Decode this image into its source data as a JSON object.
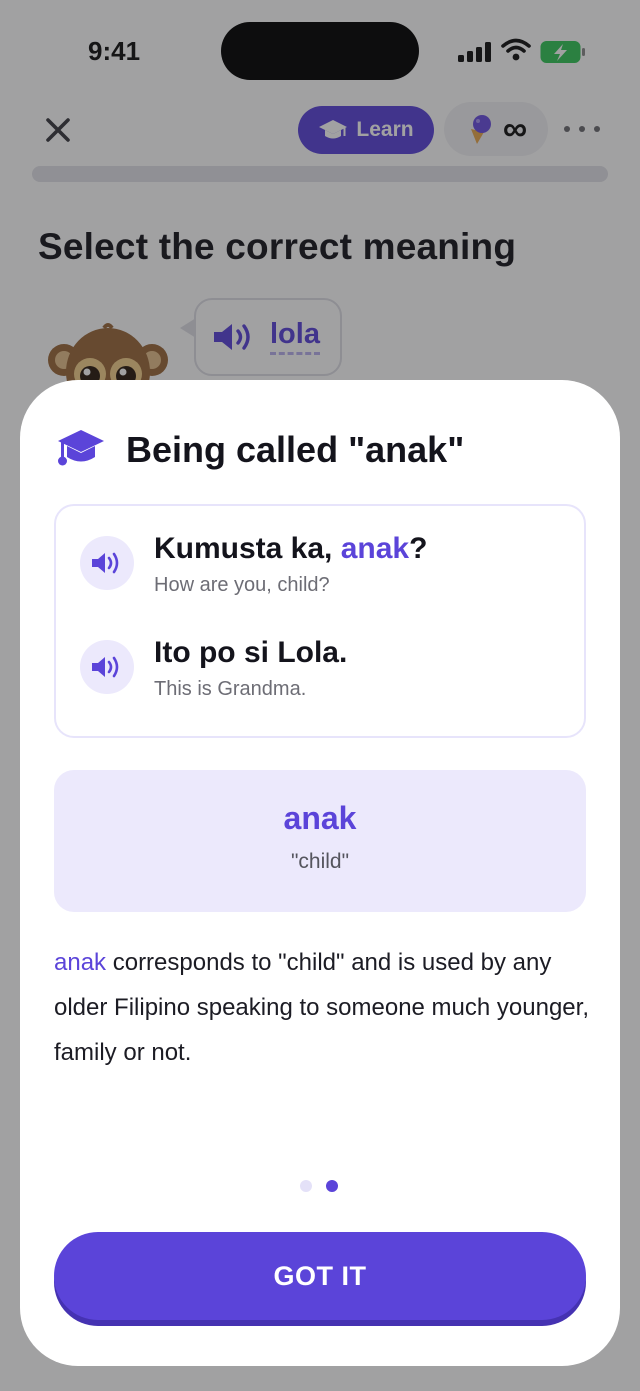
{
  "status_bar": {
    "time": "9:41"
  },
  "top_bar": {
    "learn_label": "Learn",
    "hearts_value": "∞"
  },
  "question": {
    "prompt": "Select the correct meaning",
    "word": "lola"
  },
  "sheet": {
    "title": "Being called \"anak\"",
    "examples": [
      {
        "before": "Kumusta ka, ",
        "highlight": "anak",
        "after": "?",
        "translation": "How are you, child?"
      },
      {
        "before": "Ito po si Lola.",
        "highlight": "",
        "after": "",
        "translation": "This is Grandma."
      }
    ],
    "card": {
      "word": "anak",
      "gloss": "\"child\""
    },
    "explanation": {
      "highlight": "anak",
      "rest": " corresponds to \"child\" and is used by any older Filipino speaking to someone much younger, family or not."
    },
    "pager": {
      "current": 2,
      "total": 2
    },
    "button_label": "GOT IT"
  },
  "colors": {
    "accent": "#5b44d9",
    "accent_light": "#ece9fc",
    "dot_inactive": "#e4e1f8"
  }
}
